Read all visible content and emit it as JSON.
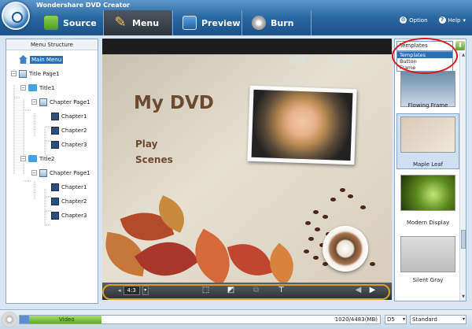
{
  "app": {
    "title": "Wondershare DVD Creator"
  },
  "toolbar": {
    "tabs": [
      {
        "label": "Source",
        "icon": "source-icon"
      },
      {
        "label": "Menu",
        "icon": "menu-edit-icon",
        "active": true
      },
      {
        "label": "Preview",
        "icon": "preview-icon"
      },
      {
        "label": "Burn",
        "icon": "burn-disc-icon"
      }
    ],
    "option_label": "Option",
    "help_label": "Help"
  },
  "menu_structure": {
    "header": "Menu Structure",
    "items": [
      {
        "label": "Main Menu",
        "level": 0,
        "selected": true
      },
      {
        "label": "Title Page1",
        "level": 0
      },
      {
        "label": "Title1",
        "level": 1
      },
      {
        "label": "Chapter Page1",
        "level": 2
      },
      {
        "label": "Chapter1",
        "level": 3
      },
      {
        "label": "Chapter2",
        "level": 3
      },
      {
        "label": "Chapter3",
        "level": 3
      },
      {
        "label": "Title2",
        "level": 1
      },
      {
        "label": "Chapter Page1",
        "level": 2
      },
      {
        "label": "Chapter1",
        "level": 3
      },
      {
        "label": "Chapter2",
        "level": 3
      },
      {
        "label": "Chapter3",
        "level": 3
      }
    ]
  },
  "canvas": {
    "title": "My DVD",
    "links": [
      "Play",
      "Scenes"
    ]
  },
  "controls": {
    "aspect_ratio": "4:3"
  },
  "templates": {
    "selected": "Templates",
    "options": [
      "Templates",
      "Button",
      "Frame"
    ],
    "items": [
      {
        "label": "Flowing Frame"
      },
      {
        "label": "Maple Leaf",
        "selected": true
      },
      {
        "label": "Modern Display"
      },
      {
        "label": "Silent Gray"
      }
    ]
  },
  "status": {
    "segment_label": "Video",
    "capacity": "1020/4483(MB)",
    "used_fraction": 0.228,
    "disc_type": "D5",
    "quality": "Standard"
  },
  "colors": {
    "accent_blue": "#2c6fb4",
    "highlight_orange": "#d8a11e",
    "annotation_red": "#d21c1c",
    "capacity_green": "#5da824"
  }
}
